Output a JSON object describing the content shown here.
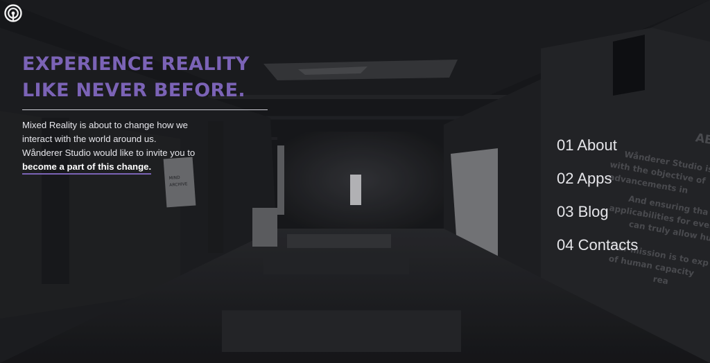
{
  "hero": {
    "headline_line1": "EXPERIENCE REALITY",
    "headline_line2": "LIKE NEVER BEFORE.",
    "intro_line1": "Mixed Reality is about to change how we",
    "intro_line2": "interact with the world around us.",
    "intro_line3": "Wånderer Studio would like to invite you to",
    "cta_label": "become a part of this change."
  },
  "nav": {
    "items": [
      {
        "label": "01 About"
      },
      {
        "label": "02 Apps"
      },
      {
        "label": "03 Blog"
      },
      {
        "label": "04 Contacts"
      }
    ]
  },
  "background": {
    "sign_line1": "MIND",
    "sign_line2": "ARCHIVE",
    "wall_text": [
      "ABO",
      "Wånderer Studio is c",
      "with the objective of",
      "advancements in",
      "And ensuring tha",
      "applicabilities for ever",
      "can truly allow hu",
      "Our mission is to exp",
      "of human capacity",
      "rea"
    ]
  },
  "colors": {
    "accent": "#7b63b6",
    "background": "#1b1c1f",
    "text": "#e7e7ec"
  },
  "icons": {
    "logo": "concentric-circles-logo-icon"
  }
}
